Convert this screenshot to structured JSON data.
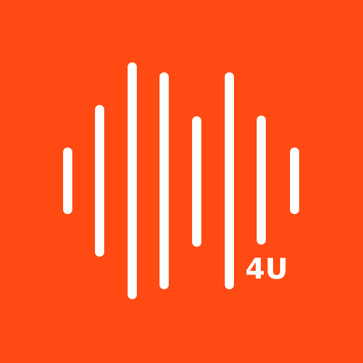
{
  "icon": {
    "name": "sound-wave-logo",
    "background_color": "#ff4a13",
    "foreground_color": "#ffffff",
    "badge_text": "4U"
  }
}
